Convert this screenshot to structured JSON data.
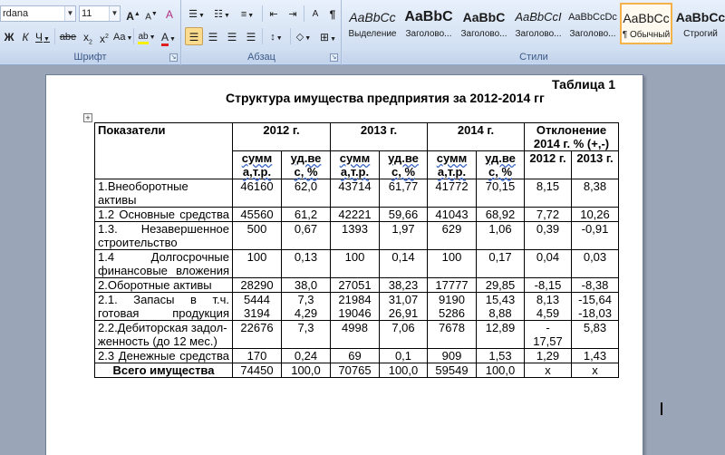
{
  "ribbon": {
    "font": {
      "font_name": "rdana",
      "font_size": "11",
      "grow_label": "A",
      "shrink_label": "A",
      "clear_label": "A",
      "bold": "Ж",
      "italic": "К",
      "underline": "Ч",
      "strike": "abe",
      "subscript": "x",
      "superscript": "x",
      "case": "Aa",
      "highlight": "ab",
      "color": "A",
      "group_label": "Шрифт"
    },
    "paragraph": {
      "group_label": "Абзац",
      "pilcrow": "¶",
      "sort": "A",
      "shading": "◇"
    },
    "styles": {
      "group_label": "Стили",
      "items": [
        {
          "sample": "AaBbCc",
          "name": "Выделение"
        },
        {
          "sample": "AaBbC",
          "name": "Заголово..."
        },
        {
          "sample": "AaBbC",
          "name": "Заголово..."
        },
        {
          "sample": "AaBbCcI",
          "name": "Заголово..."
        },
        {
          "sample": "AaBbCcDc",
          "name": "Заголово..."
        },
        {
          "sample": "AaBbCc",
          "name": "¶ Обычный"
        },
        {
          "sample": "AaBbCc",
          "name": "Строгий"
        }
      ]
    }
  },
  "document": {
    "table_label": "Таблица 1",
    "table_title": "Структура имущества предприятия за 2012-2014 гг",
    "headers": {
      "indicator": "Показатели",
      "y2012": "2012 г.",
      "y2013": "2013 г.",
      "y2014": "2014 г.",
      "deviation": "Отклонение 2014 г. % (+,-)",
      "sum_a": "сумм",
      "sum_b": "а,т.р.",
      "share_a": "уд.ве",
      "share_b": "с, %",
      "dev_2012": "2012 г.",
      "dev_2013": "2013 г."
    },
    "rows": [
      {
        "label": "1.Внеоборотные активы",
        "v": [
          "46160",
          "62,0",
          "43714",
          "61,77",
          "41772",
          "70,15",
          "8,15",
          "8,38"
        ]
      },
      {
        "label": "1.2 Основные средства",
        "v": [
          "45560",
          "61,2",
          "42221",
          "59,66",
          "41043",
          "68,92",
          "7,72",
          "10,26"
        ]
      },
      {
        "label": "1.3. Незавершенное строительство",
        "v": [
          "500",
          "0,67",
          "1393",
          "1,97",
          "629",
          "1,06",
          "0,39",
          "-0,91"
        ]
      },
      {
        "label": "1.4 Долгосрочные финансовые вложения",
        "v": [
          "100",
          "0,13",
          "100",
          "0,14",
          "100",
          "0,17",
          "0,04",
          "0,03"
        ]
      },
      {
        "label": "2.Оборотные активы",
        "v": [
          "28290",
          "38,0",
          "27051",
          "38,23",
          "17777",
          "29,85",
          "-8,15",
          "-8,38"
        ]
      },
      {
        "label": "2.1. Запасы в т.ч. готовая продукция",
        "v": [
          "5444\n3194",
          "7,3\n4,29",
          "21984\n19046",
          "31,07\n26,91",
          "9190\n5286",
          "15,43\n8,88",
          "8,13\n4,59",
          "-15,64\n-18,03"
        ]
      },
      {
        "label": "2.2.Дебиторская задол-женность (до 12 мес.)",
        "v": [
          "22676",
          "7,3",
          "4998",
          "7,06",
          "7678",
          "12,89",
          "-\n17,57",
          "5,83"
        ]
      },
      {
        "label": "2.3 Денежные средства",
        "v": [
          "170",
          "0,24",
          "69",
          "0,1",
          "909",
          "1,53",
          "1,29",
          "1,43"
        ]
      },
      {
        "label": "Всего имущества",
        "v": [
          "74450",
          "100,0",
          "70765",
          "100,0",
          "59549",
          "100,0",
          "x",
          "x"
        ]
      }
    ]
  }
}
